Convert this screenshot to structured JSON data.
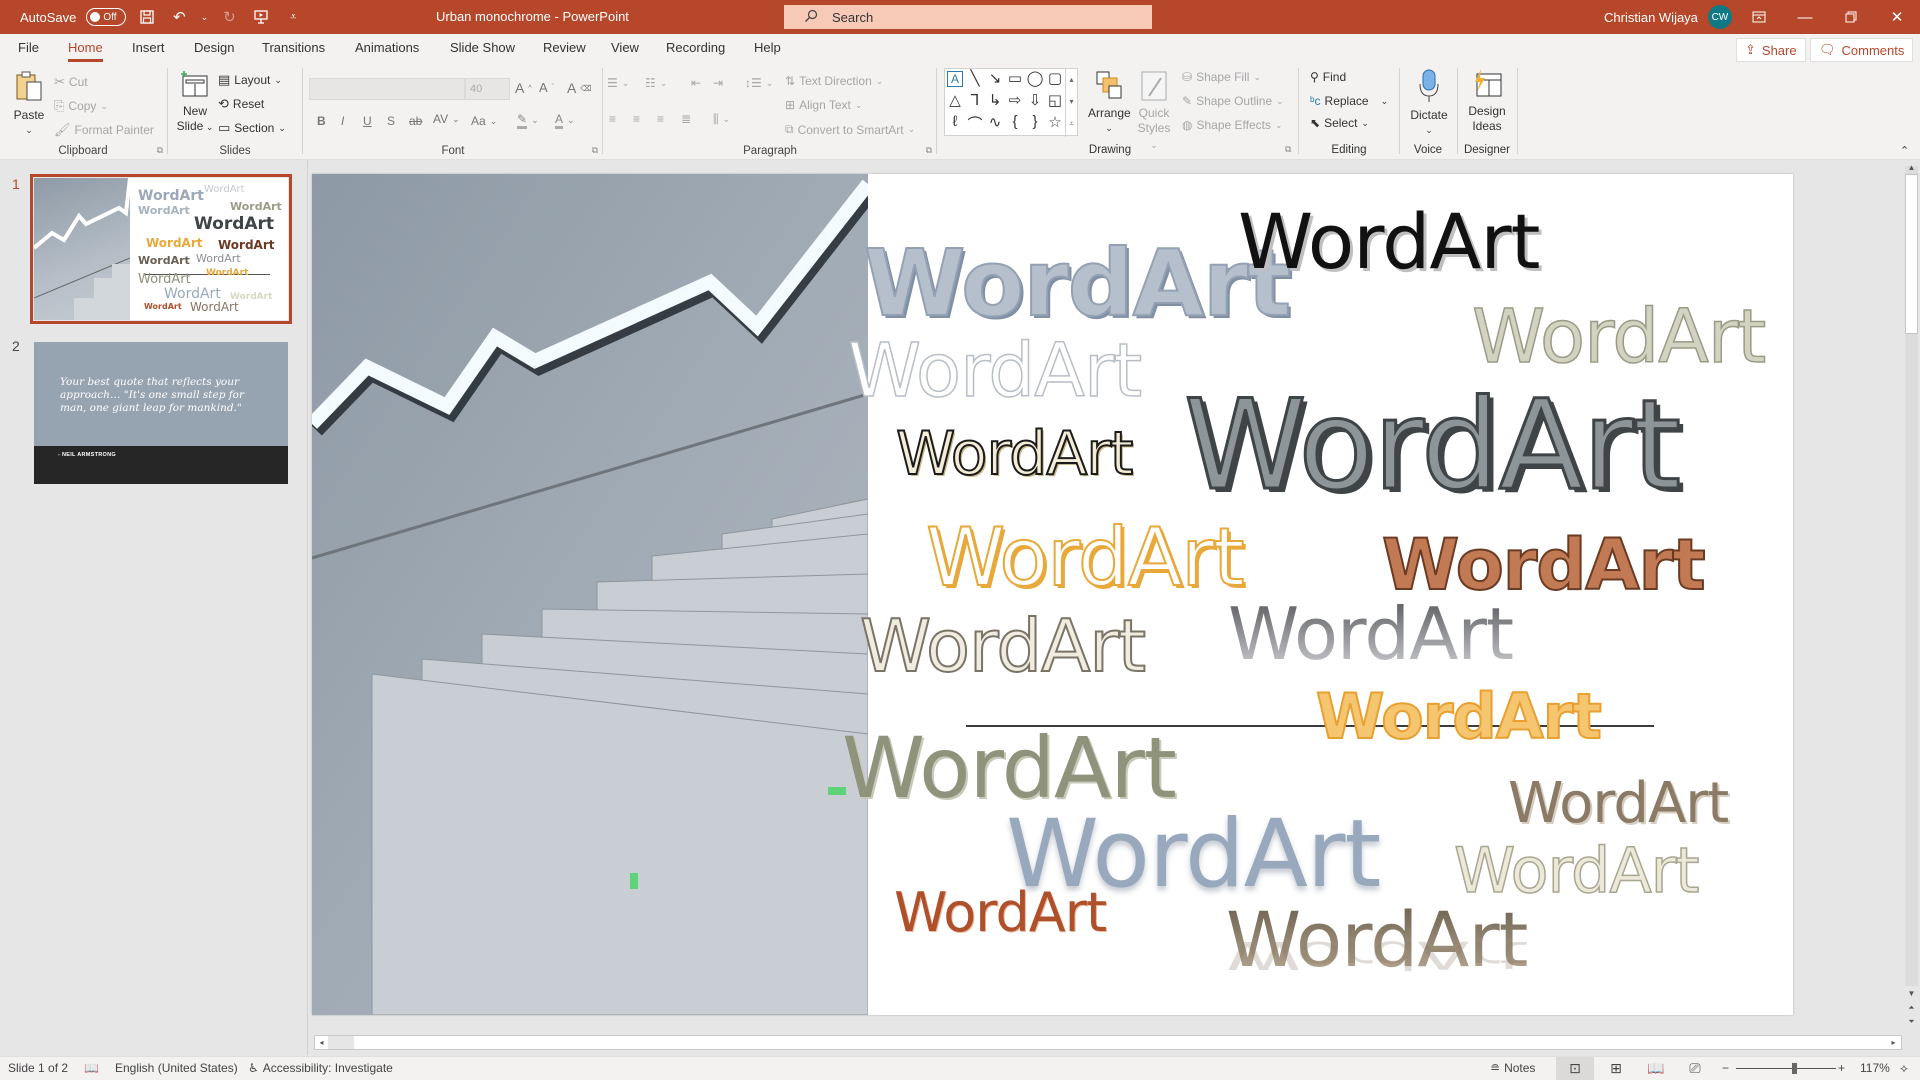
{
  "titlebar": {
    "autosave_label": "AutoSave",
    "autosave_state": "Off",
    "doc_title": "Urban monochrome  -  PowerPoint",
    "search_placeholder": "Search",
    "user_name": "Christian Wijaya",
    "user_initials": "CW",
    "accent_color": "#B7472A"
  },
  "tabs": [
    {
      "label": "File"
    },
    {
      "label": "Home",
      "active": true
    },
    {
      "label": "Insert"
    },
    {
      "label": "Design"
    },
    {
      "label": "Transitions"
    },
    {
      "label": "Animations"
    },
    {
      "label": "Slide Show"
    },
    {
      "label": "Review"
    },
    {
      "label": "View"
    },
    {
      "label": "Recording"
    },
    {
      "label": "Help"
    }
  ],
  "top_buttons": {
    "share": "Share",
    "comments": "Comments"
  },
  "ribbon": {
    "clipboard": {
      "label": "Clipboard",
      "paste": "Paste",
      "cut": "Cut",
      "copy": "Copy",
      "format_painter": "Format Painter"
    },
    "slides": {
      "label": "Slides",
      "new_slide_1": "New",
      "new_slide_2": "Slide",
      "layout": "Layout",
      "reset": "Reset",
      "section": "Section"
    },
    "font": {
      "label": "Font",
      "font_name": "",
      "font_size": "40",
      "bold": "B",
      "italic": "I",
      "underline": "U",
      "shadow": "S",
      "strike": "ab",
      "spacing": "AV",
      "case": "Aa"
    },
    "paragraph": {
      "label": "Paragraph",
      "text_direction": "Text Direction",
      "align_text": "Align Text",
      "convert_smartart": "Convert to SmartArt"
    },
    "drawing": {
      "label": "Drawing",
      "arrange": "Arrange",
      "quick_styles_1": "Quick",
      "quick_styles_2": "Styles",
      "shape_fill": "Shape Fill",
      "shape_outline": "Shape Outline",
      "shape_effects": "Shape Effects"
    },
    "editing": {
      "label": "Editing",
      "find": "Find",
      "replace": "Replace",
      "select": "Select"
    },
    "voice": {
      "label": "Voice",
      "dictate": "Dictate"
    },
    "designer": {
      "label": "Designer",
      "design_ideas_1": "Design",
      "design_ideas_2": "Ideas"
    }
  },
  "slides_panel": {
    "slides": [
      {
        "number": "1",
        "selected": true
      },
      {
        "number": "2",
        "quote": "Your best quote that reflects your approach… \"It's one small step for man, one giant leap for mankind.\"",
        "author": "- NEIL ARMSTRONG"
      }
    ]
  },
  "slide": {
    "wordart_text": "WordArt",
    "wordart_colors": {
      "blue_gray": "#9aa8b8",
      "black": "#111111",
      "sage": "#c9c9b5",
      "white_outline": "#c8ccd2",
      "dark_outline": "#222222",
      "charcoal_hatch": "#3f4446",
      "gold": "#e8a93a",
      "rust": "#a3553a",
      "cream_hatch": "#8a8474",
      "gray_gradient": "#6c6e72",
      "orange_fill": "#f1b656",
      "olive": "#8f937c",
      "taupe": "#8a7a66",
      "light_blue": "#98a9bd",
      "ivory": "#d9d7c6",
      "burnt_orange": "#b0502a",
      "bronze": "#857560"
    }
  },
  "status": {
    "slide_count": "Slide 1 of 2",
    "language": "English (United States)",
    "accessibility": "Accessibility: Investigate",
    "notes": "Notes",
    "zoom": "117%",
    "zoom_fraction": 0.58
  }
}
